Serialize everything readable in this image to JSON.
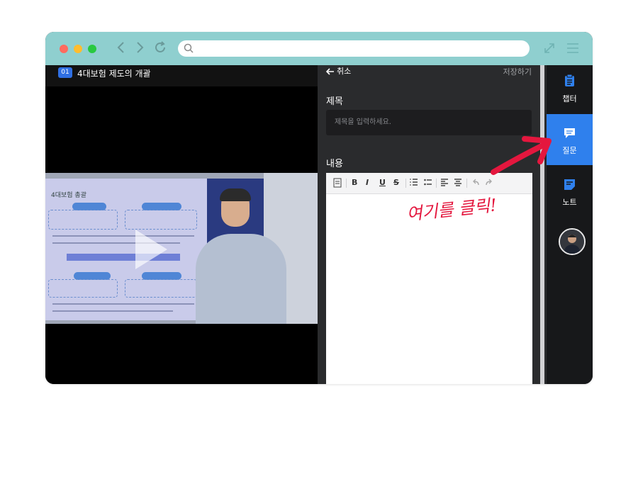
{
  "video": {
    "lesson_number": "01",
    "lesson_title": "4대보험 제도의 개괄",
    "slide_title": "4대보험 총괄"
  },
  "question_form": {
    "cancel_label": "취소",
    "save_label": "저장하기",
    "title_label": "제목",
    "title_placeholder": "제목을 입력하세요.",
    "content_label": "내용"
  },
  "editor_toolbar": {
    "bold": "B",
    "italic": "I",
    "underline": "U",
    "strike": "S"
  },
  "sidebar": {
    "items": [
      {
        "label": "챕터",
        "icon": "clipboard-icon"
      },
      {
        "label": "질문",
        "icon": "chat-icon",
        "active": true
      },
      {
        "label": "노트",
        "icon": "note-icon"
      }
    ]
  },
  "annotation": {
    "text": "여기를 클릭!"
  },
  "colors": {
    "titlebar": "#8fcfcf",
    "accent": "#2f80ed",
    "annotation": "#e4173e",
    "lesson_badge": "#2f6fe3"
  }
}
